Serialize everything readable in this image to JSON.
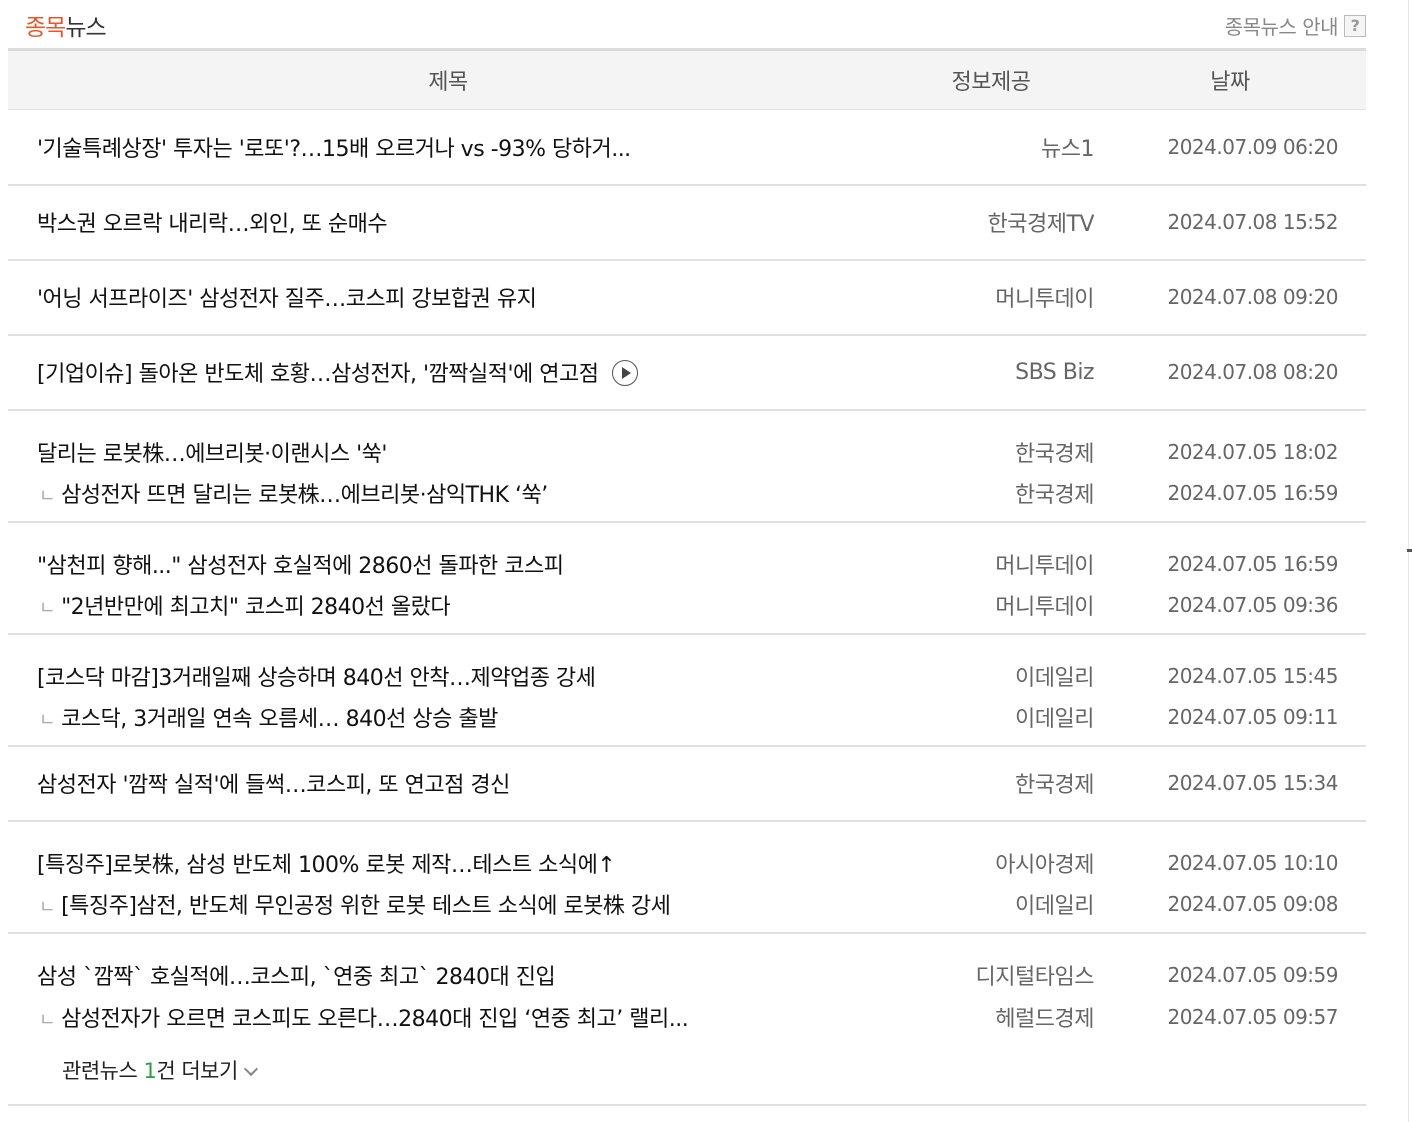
{
  "header": {
    "title_accent": "종목",
    "title_rest": "뉴스",
    "guide_label": "종목뉴스 안내",
    "help_glyph": "?"
  },
  "columns": {
    "title": "제목",
    "source": "정보제공",
    "date": "날짜"
  },
  "groups": [
    {
      "items": [
        {
          "title": "'기술특례상장' 투자는 '로또'?…15배 오르거나 vs -93% 당하거...",
          "source": "뉴스1",
          "date": "2024.07.09 06:20"
        }
      ]
    },
    {
      "items": [
        {
          "title": "박스권 오르락 내리락…외인, 또 순매수",
          "source": "한국경제TV",
          "date": "2024.07.08 15:52"
        }
      ]
    },
    {
      "items": [
        {
          "title": "'어닝 서프라이즈' 삼성전자 질주…코스피 강보합권 유지",
          "source": "머니투데이",
          "date": "2024.07.08 09:20"
        }
      ]
    },
    {
      "items": [
        {
          "title": "[기업이슈] 돌아온 반도체 호황…삼성전자, '깜짝실적'에 연고점",
          "source": "SBS Biz",
          "date": "2024.07.08 08:20",
          "video": true
        }
      ]
    },
    {
      "items": [
        {
          "title": "달리는 로봇株…에브리봇·이랜시스 '쑥'",
          "source": "한국경제",
          "date": "2024.07.05 18:02"
        },
        {
          "title": "삼성전자 뜨면 달리는 로봇株…에브리봇·삼익THK ‘쑥’",
          "source": "한국경제",
          "date": "2024.07.05 16:59"
        }
      ]
    },
    {
      "items": [
        {
          "title": "\"삼천피 향해...\" 삼성전자 호실적에 2860선 돌파한 코스피",
          "source": "머니투데이",
          "date": "2024.07.05 16:59"
        },
        {
          "title": "\"2년반만에 최고치\" 코스피 2840선 올랐다",
          "source": "머니투데이",
          "date": "2024.07.05 09:36"
        }
      ]
    },
    {
      "items": [
        {
          "title": "[코스닥 마감]3거래일째 상승하며 840선 안착…제약업종 강세",
          "source": "이데일리",
          "date": "2024.07.05 15:45"
        },
        {
          "title": "코스닥, 3거래일 연속 오름세… 840선 상승 출발",
          "source": "이데일리",
          "date": "2024.07.05 09:11"
        }
      ]
    },
    {
      "items": [
        {
          "title": "삼성전자 '깜짝 실적'에 들썩…코스피, 또 연고점 경신",
          "source": "한국경제",
          "date": "2024.07.05 15:34"
        }
      ]
    },
    {
      "items": [
        {
          "title": "[특징주]로봇株, 삼성 반도체 100% 로봇 제작…테스트 소식에↑",
          "source": "아시아경제",
          "date": "2024.07.05 10:10"
        },
        {
          "title": "[특징주]삼전, 반도체 무인공정 위한 로봇 테스트 소식에 로봇株 강세",
          "source": "이데일리",
          "date": "2024.07.05 09:08"
        }
      ]
    },
    {
      "items": [
        {
          "title": "삼성 `깜짝` 호실적에…코스피, `연중 최고` 2840대 진입",
          "source": "디지털타임스",
          "date": "2024.07.05 09:59"
        },
        {
          "title": "삼성전자가 오르면 코스피도 오른다…2840대 진입 ‘연중 최고’ 랠리...",
          "source": "헤럴드경제",
          "date": "2024.07.05 09:57"
        }
      ],
      "more": {
        "prefix": "관련뉴스 ",
        "count": "1",
        "suffix": "건 더보기"
      }
    }
  ],
  "sub_marker": "ㄴ",
  "colors": {
    "accent": "#e4572e",
    "count": "#2e9e3e",
    "border": "#e0e0e0"
  },
  "icons": {
    "help": "question-mark-box",
    "play": "play-circle",
    "more": "chevron-down"
  }
}
